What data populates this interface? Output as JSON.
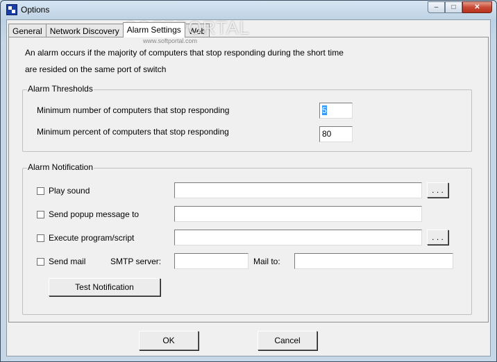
{
  "window": {
    "title": "Options",
    "minimize": "–",
    "maximize": "□",
    "close": "✕"
  },
  "tabs": [
    "General",
    "Network Discovery",
    "Alarm Settings",
    "Web"
  ],
  "description": {
    "line1": "An alarm occurs if the majority of computers that stop responding  during the short time",
    "line2": "are resided on the same port of switch"
  },
  "thresholds": {
    "title": "Alarm Thresholds",
    "min_count_label": "Minimum number of computers that stop responding",
    "min_count_value": "5",
    "min_percent_label": "Minimum  percent of computers that stop responding",
    "min_percent_value": "80"
  },
  "notification": {
    "title": "Alarm Notification",
    "play_sound_label": "Play sound",
    "popup_label": "Send popup message to",
    "execute_label": "Execute program/script",
    "send_mail_label": "Send mail",
    "smtp_label": "SMTP server:",
    "mail_to_label": "Mail to:",
    "browse_label": ". . .",
    "test_button": "Test Notification"
  },
  "footer": {
    "ok": "OK",
    "cancel": "Cancel"
  },
  "watermark": {
    "brand": "SOFTPORTAL",
    "url": "www.softportal.com"
  }
}
